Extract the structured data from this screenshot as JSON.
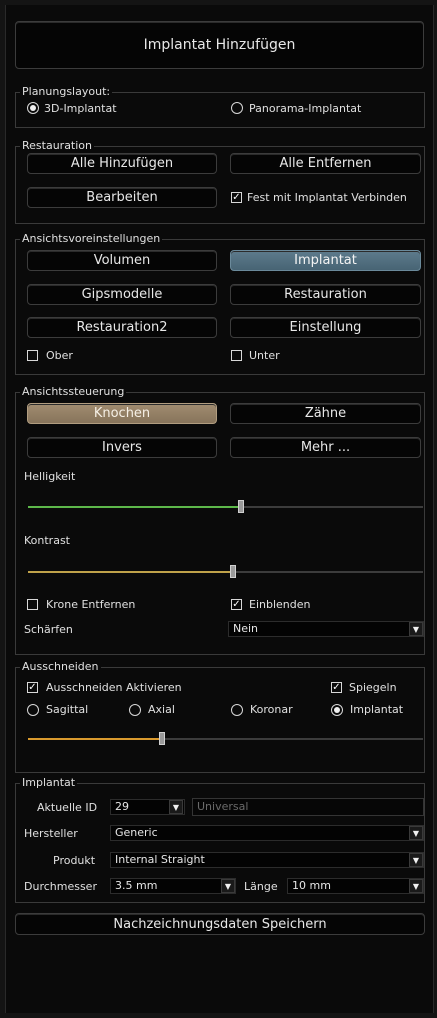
{
  "header": {
    "add_implant": "Implantat Hinzufügen"
  },
  "planning": {
    "title": "Planungslayout:",
    "option_3d": "3D-Implantat",
    "option_panorama": "Panorama-Implantat",
    "selected": "3d"
  },
  "restoration": {
    "title": "Restauration",
    "add_all": "Alle Hinzufügen",
    "remove_all": "Alle Entfernen",
    "edit": "Bearbeiten",
    "fix_label": "Fest mit Implantat Verbinden",
    "fix_checked": true
  },
  "view_presets": {
    "title": "Ansichtsvoreinstellungen",
    "volume": "Volumen",
    "implant": "Implantat",
    "plaster": "Gipsmodelle",
    "restoration": "Restauration",
    "restoration2": "Restauration2",
    "setting": "Einstellung",
    "upper": "Ober",
    "lower": "Unter",
    "active": "implant"
  },
  "view_control": {
    "title": "Ansichtssteuerung",
    "bone": "Knochen",
    "teeth": "Zähne",
    "invert": "Invers",
    "more": "Mehr ...",
    "brightness_label": "Helligkeit",
    "brightness_value": 0.54,
    "contrast_label": "Kontrast",
    "contrast_value": 0.52,
    "remove_crown": "Krone Entfernen",
    "remove_crown_checked": false,
    "show": "Einblenden",
    "show_checked": true,
    "sharpen_label": "Schärfen",
    "sharpen_value": "Nein",
    "colors": {
      "brightness": "#5db84a",
      "contrast": "#c0a24a"
    }
  },
  "clipping": {
    "title": "Ausschneiden",
    "activate": "Ausschneiden Aktivieren",
    "activate_checked": true,
    "mirror": "Spiegeln",
    "mirror_checked": true,
    "sagittal": "Sagittal",
    "axial": "Axial",
    "coronal": "Koronar",
    "implant": "Implantat",
    "selected": "implant",
    "slider_value": 0.34,
    "color": "#d99a2e"
  },
  "implant": {
    "title": "Implantat",
    "current_id_label": "Aktuelle ID",
    "current_id_value": "29",
    "universal_placeholder": "Universal",
    "manufacturer_label": "Hersteller",
    "manufacturer_value": "Generic",
    "product_label": "Produkt",
    "product_value": "Internal Straight",
    "diameter_label": "Durchmesser",
    "diameter_value": "3.5 mm",
    "length_label": "Länge",
    "length_value": "10 mm"
  },
  "footer": {
    "save_tracing": "Nachzeichnungsdaten Speichern"
  }
}
